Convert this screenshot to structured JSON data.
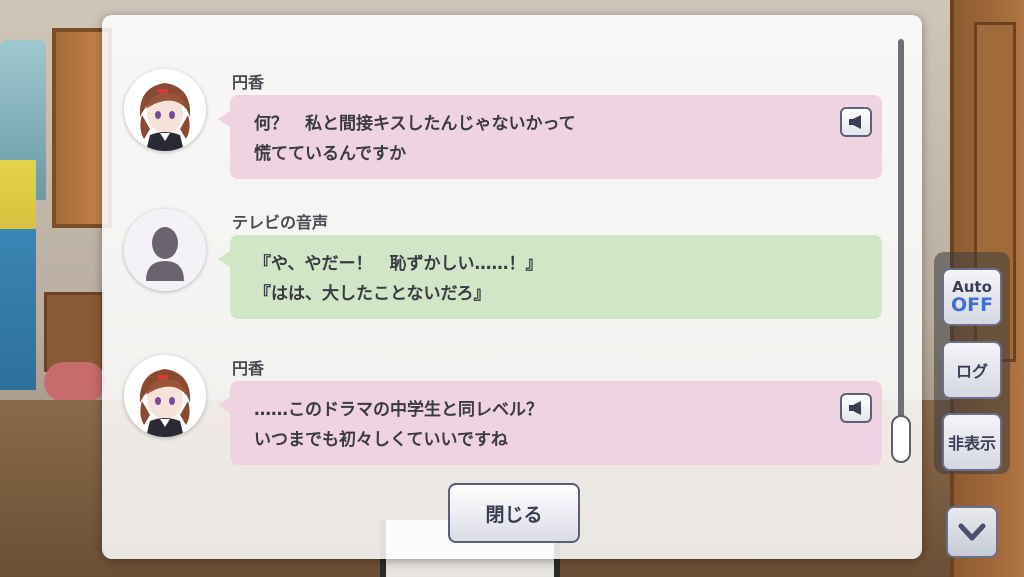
{
  "log": {
    "entries": [
      {
        "speaker": "円香",
        "avatar_icon": "madoka-portrait",
        "line1": "何？　私と間接キスしたんじゃないかって",
        "line2": "慌てているんですか",
        "color": "#efd3e0",
        "has_voice": true
      },
      {
        "speaker": "テレビの音声",
        "avatar_icon": "silhouette-icon",
        "line1": "『や、やだー！　恥ずかしい……！』",
        "line2": "『はは、大したことないだろ』",
        "color": "#d1e6c7",
        "has_voice": false
      },
      {
        "speaker": "円香",
        "avatar_icon": "madoka-portrait",
        "line1": "……このドラマの中学生と同レベル？",
        "line2": "いつまでも初々しくていいですね",
        "color": "#efd3e0",
        "has_voice": true
      }
    ],
    "close_label": "閉じる"
  },
  "controls": {
    "auto_top": "Auto",
    "auto_state": "OFF",
    "log_label": "ログ",
    "hide_label": "非表示",
    "next_icon": "chevron-down-icon"
  }
}
